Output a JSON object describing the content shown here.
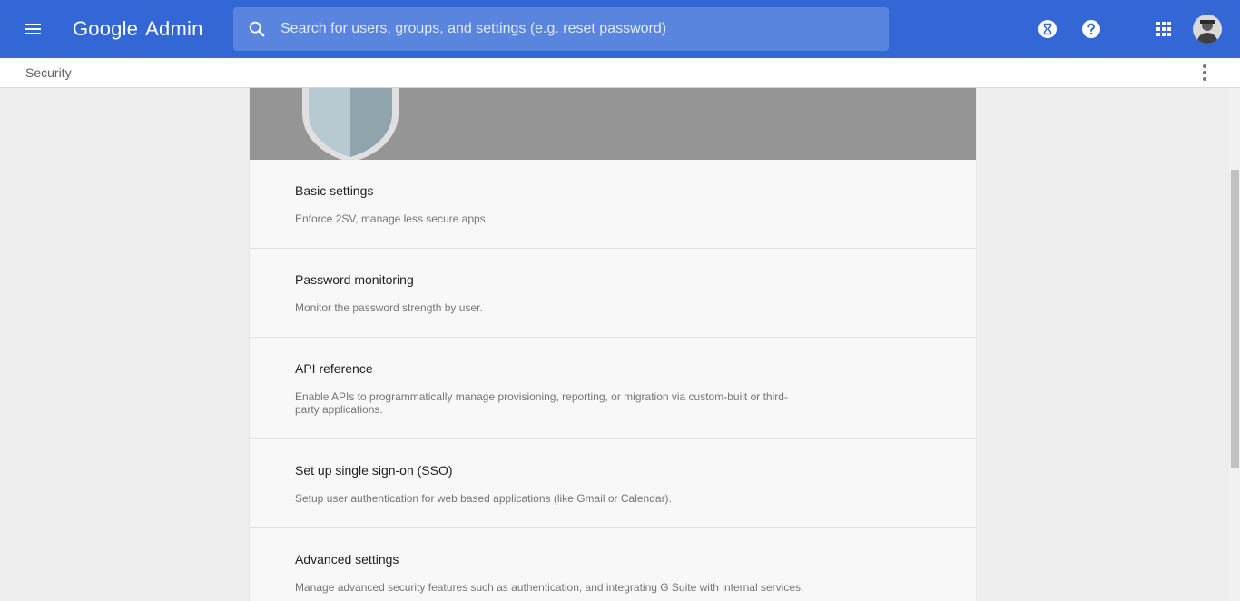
{
  "app": {
    "brand_google": "Google",
    "brand_admin": "Admin"
  },
  "search": {
    "placeholder": "Search for users, groups, and settings (e.g. reset password)"
  },
  "topbar": {
    "icons": [
      "menu-icon",
      "search-icon",
      "hourglass-icon",
      "help-icon",
      "apps-grid-icon",
      "avatar"
    ],
    "accent_color": "#3367d6"
  },
  "breadcrumb": {
    "label": "Security"
  },
  "sections": [
    {
      "title": "Basic settings",
      "description": "Enforce 2SV, manage less secure apps."
    },
    {
      "title": "Password monitoring",
      "description": "Monitor the password strength by user."
    },
    {
      "title": "API reference",
      "description": "Enable APIs to programmatically manage provisioning, reporting, or migration via custom-built or third-party applications."
    },
    {
      "title": "Set up single sign-on (SSO)",
      "description": "Setup user authentication for web based applications (like Gmail or Calendar)."
    },
    {
      "title": "Advanced settings",
      "description": "Manage advanced security features such as authentication, and integrating G Suite with internal services."
    }
  ]
}
